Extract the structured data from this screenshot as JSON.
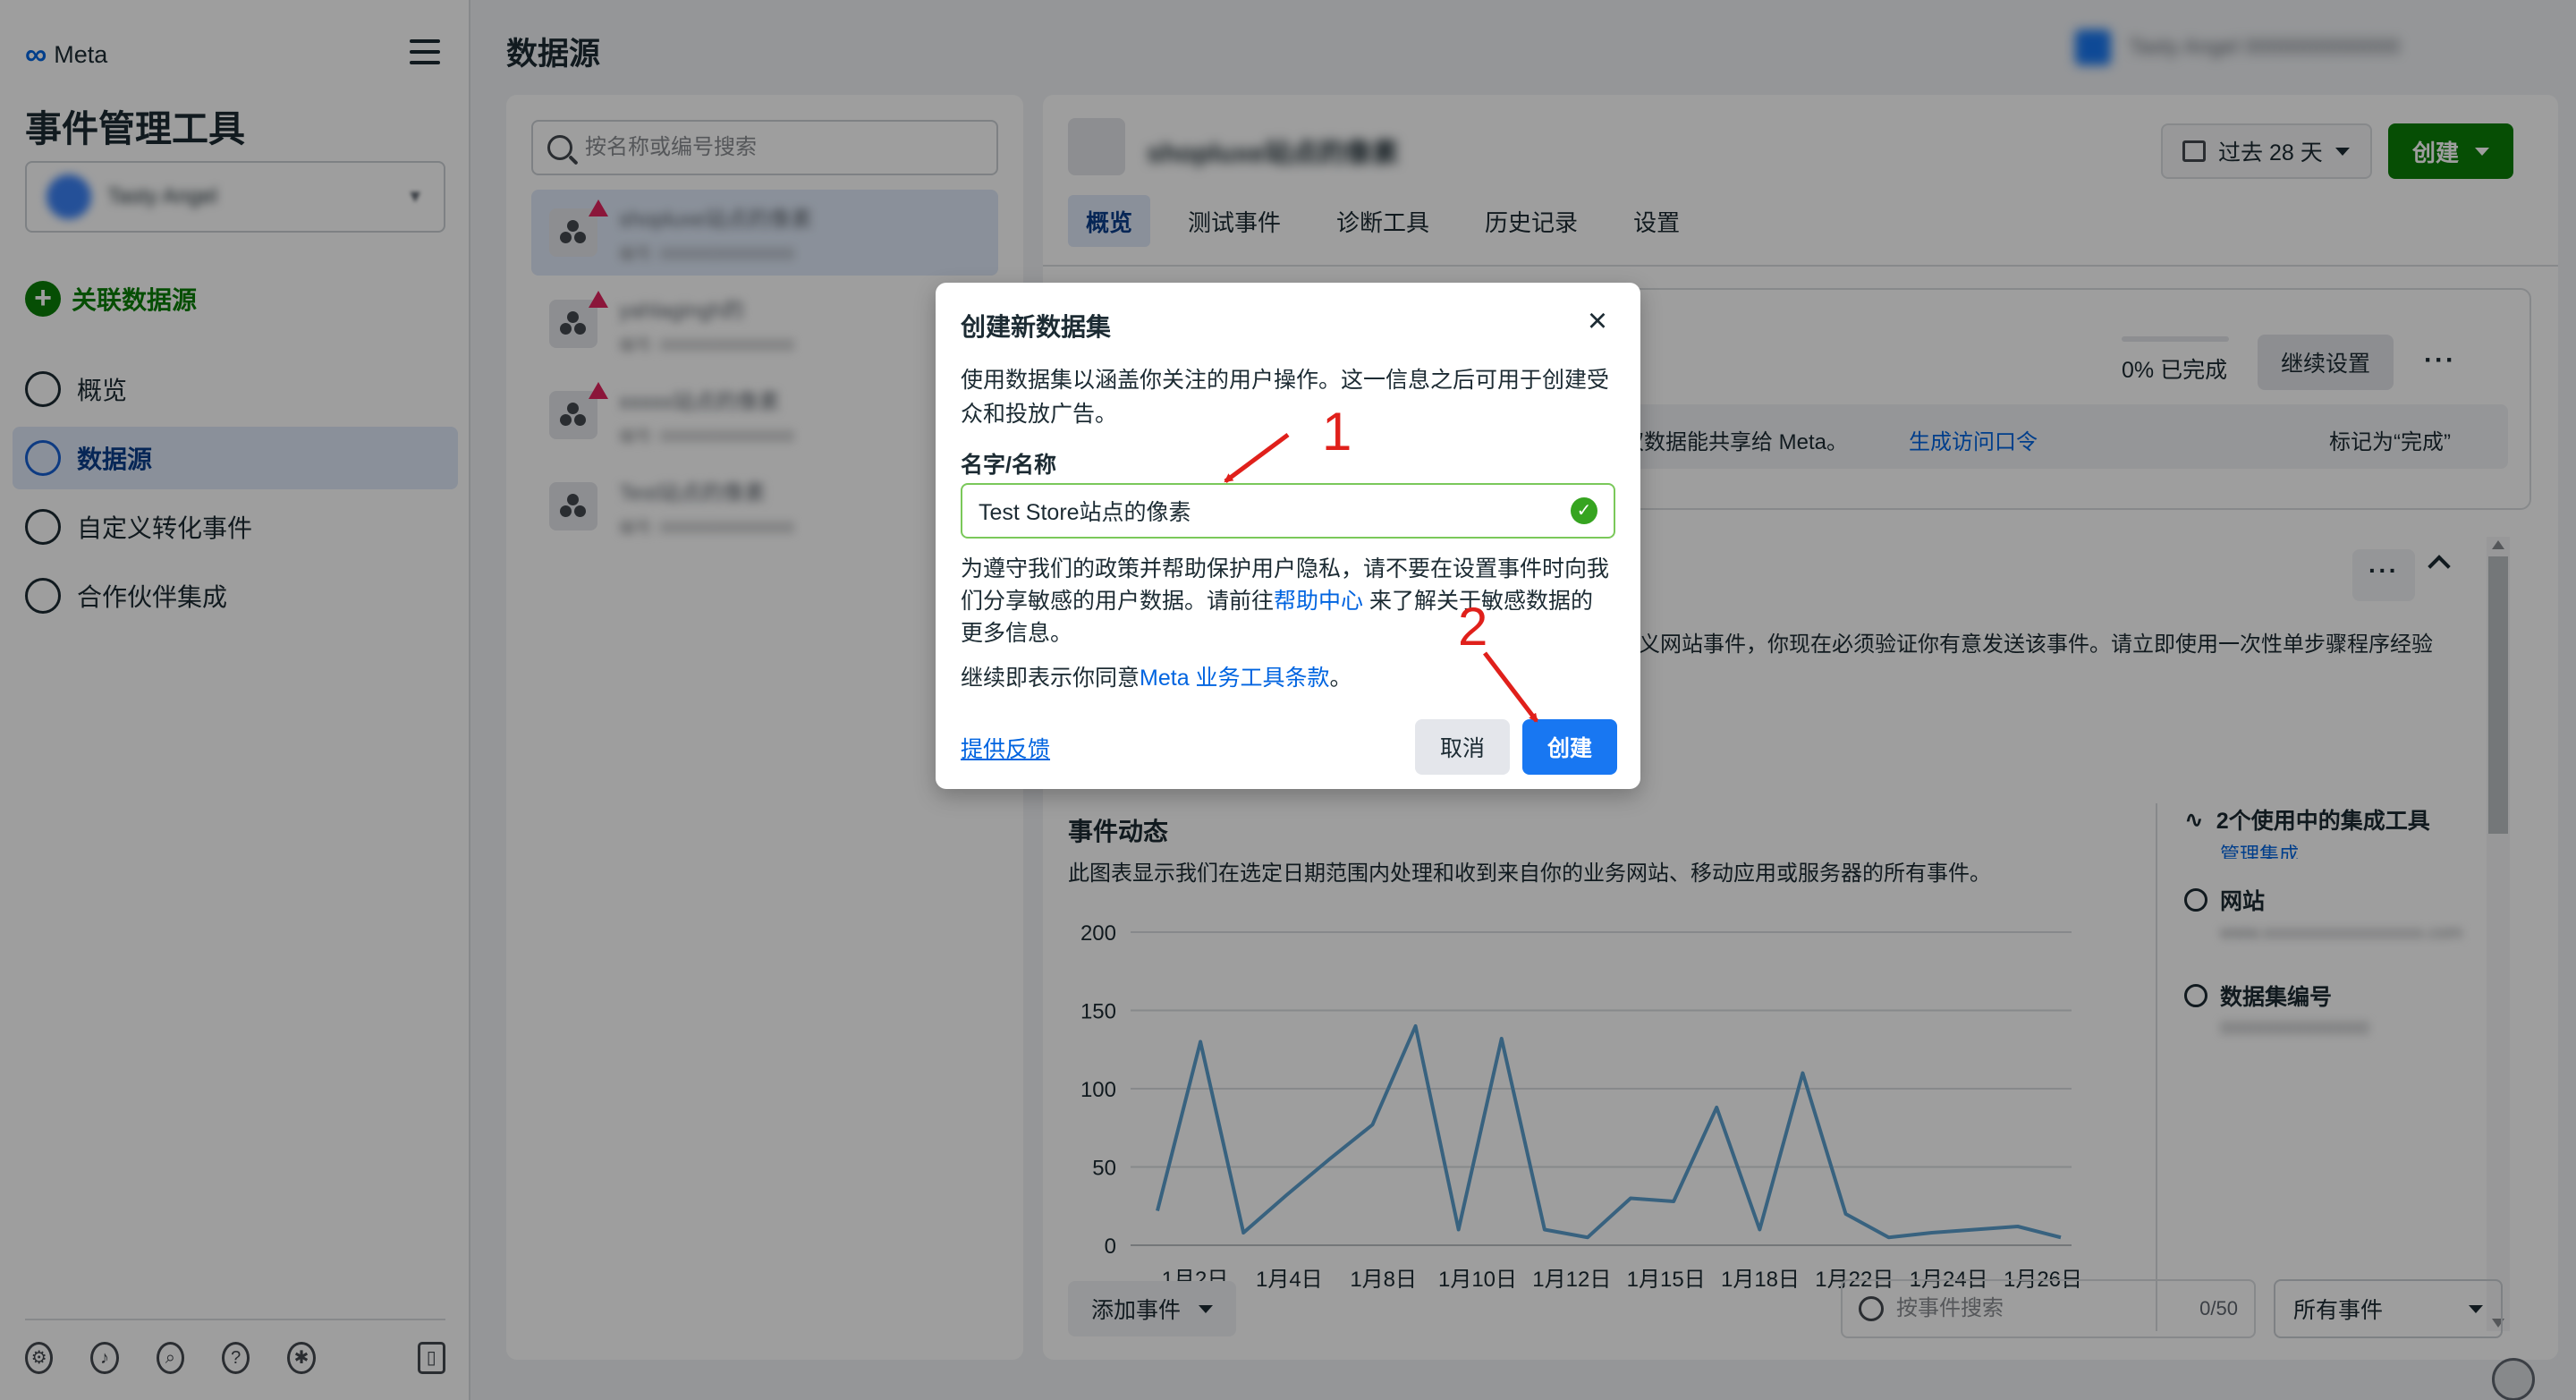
{
  "brand": {
    "name": "Meta"
  },
  "sidebar": {
    "title": "事件管理工具",
    "account_name": "Tasty Angel",
    "connect_label": "关联数据源",
    "items": [
      {
        "label": "概览",
        "icon": "dashboard-icon",
        "active": false
      },
      {
        "label": "数据源",
        "icon": "datasource-icon",
        "active": true
      },
      {
        "label": "自定义转化事件",
        "icon": "star-badge-icon",
        "active": false
      },
      {
        "label": "合作伙伴集成",
        "icon": "partner-icon",
        "active": false
      }
    ],
    "footer_icons": [
      "settings-icon",
      "bell-icon",
      "search-icon",
      "help-icon",
      "bug-icon",
      "panel-toggle-icon"
    ]
  },
  "header": {
    "title": "数据源",
    "account_info": "Tasty Angel 0000000000000"
  },
  "list": {
    "search_placeholder": "按名称或编号搜索",
    "datasets": [
      {
        "name": "shopluxe站点的像素",
        "id": "编号: 000000000000000",
        "warning": true,
        "active": true
      },
      {
        "name": "yahlagingh的",
        "id": "编号: 000000000000000",
        "warning": true,
        "active": false
      },
      {
        "name": "xxxxx站点的像素",
        "id": "编号: 000000000000000",
        "warning": true,
        "active": false
      },
      {
        "name": "Test站点的像素",
        "id": "编号: 000000000000000",
        "warning": false,
        "active": false
      }
    ]
  },
  "detail": {
    "name": "shopluxe站点的像素",
    "date_range": "过去 28 天",
    "create_label": "创建",
    "tabs": [
      {
        "label": "概览",
        "active": true
      },
      {
        "label": "测试事件",
        "active": false
      },
      {
        "label": "诊断工具",
        "active": false
      },
      {
        "label": "历史记录",
        "active": false
      },
      {
        "label": "设置",
        "active": false
      }
    ],
    "setup": {
      "progress_text": "0% 已完成",
      "progress_value": 0,
      "continue_label": "继续设置",
      "row_text": "权数据能共享给 Meta。",
      "row_link": "生成访问口令",
      "row_mark": "标记为“完成”"
    },
    "warning_text": "义网站事件，你现在必须验证你有意发送该事件。请立即使用一次性单步骤程序经验",
    "events": {
      "title": "事件动态",
      "subtitle": "此图表显示我们在选定日期范围内处理和收到来自你的业务网站、移动应用或服务器的所有事件。"
    },
    "side_info": {
      "integrations": "2个使用中的集成工具",
      "manage": "管理集成",
      "website_label": "网站",
      "website_value": "www.xxxxxxxxxxxxxxxxxx.com",
      "dataset_id_label": "数据集编号",
      "dataset_id_value": "000000000000000"
    },
    "add_event_label": "添加事件",
    "event_search_placeholder": "按事件搜索",
    "event_search_count": "0/50",
    "all_events_label": "所有事件"
  },
  "chart_data": {
    "type": "line",
    "x": [
      "1月1日",
      "1月2日",
      "1月3日",
      "1月4日",
      "1月5日",
      "1月6日",
      "1月7日",
      "1月8日",
      "1月9日",
      "1月10日",
      "1月11日",
      "1月12日",
      "1月13日",
      "1月14日",
      "1月15日",
      "1月16日",
      "1月17日",
      "1月18日",
      "1月19日",
      "1月20日",
      "1月21日",
      "1月22日",
      "1月23日",
      "1月24日",
      "1月25日",
      "1月26日",
      "1月27日",
      "1月28日"
    ],
    "tick_labels": [
      "1月2日",
      "1月4日",
      "1月8日",
      "1月10日",
      "1月12日",
      "1月15日",
      "1月18日",
      "1月22日",
      "1月24日",
      "1月26日"
    ],
    "values": [
      22,
      130,
      8,
      32,
      55,
      77,
      140,
      10,
      132,
      10,
      5,
      30,
      28,
      88,
      10,
      110,
      20,
      5,
      8,
      10,
      12,
      5
    ],
    "ylim": [
      0,
      200
    ],
    "yticks": [
      0,
      50,
      100,
      150,
      200
    ],
    "color": "#5b9fce",
    "grid": true
  },
  "modal": {
    "title": "创建新数据集",
    "description": "使用数据集以涵盖你关注的用户操作。这一信息之后可用于创建受众和投放广告。",
    "field_label": "名字/名称",
    "name_value": "Test Store站点的像素",
    "privacy_part1": "为遵守我们的政策并帮助保护用户隐私，请不要在设置事件时向我们分享敏感的用户数据。请前往",
    "privacy_link": "帮助中心",
    "privacy_part2": " 来了解关于敏感数据的更多信息。",
    "terms_part1": "继续即表示你同意",
    "terms_link": "Meta 业务工具条款",
    "terms_part2": "。",
    "feedback_label": "提供反馈",
    "cancel_label": "取消",
    "create_label": "创建"
  },
  "annotations": {
    "step1": "1",
    "step2": "2",
    "color": "#e0201b"
  }
}
